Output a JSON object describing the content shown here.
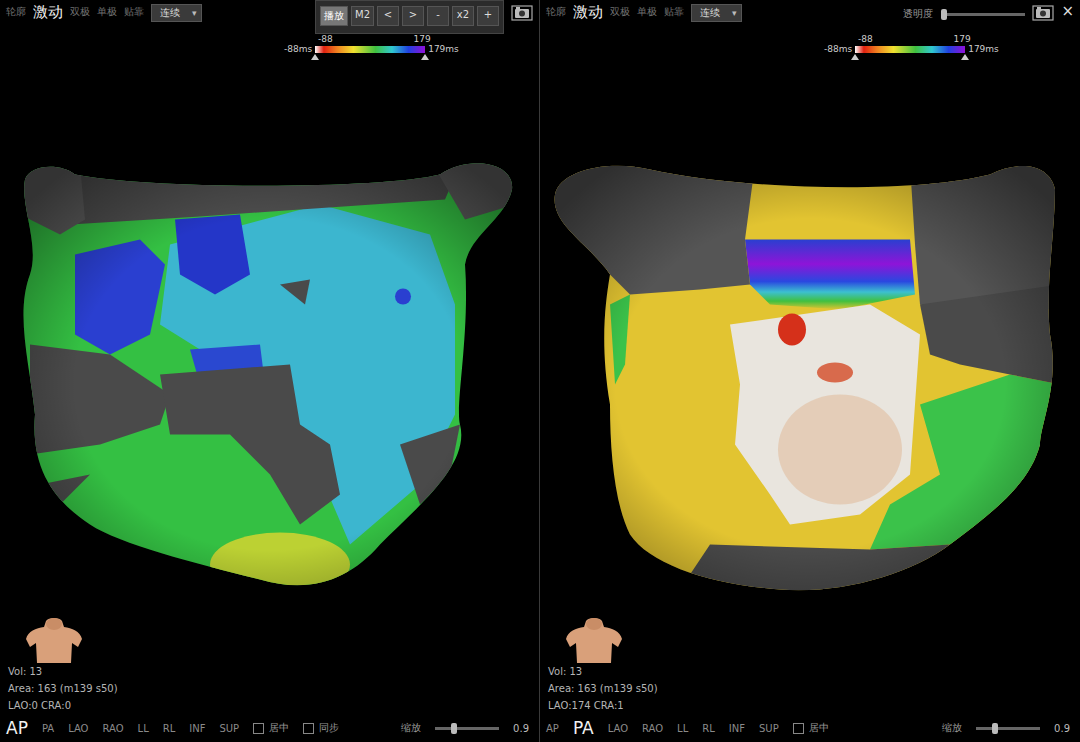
{
  "panels": [
    {
      "kind": "anterior",
      "modes": [
        {
          "label": "轮廓",
          "selected": false
        },
        {
          "label": "激动",
          "selected": true
        },
        {
          "label": "双极",
          "selected": false
        },
        {
          "label": "单极",
          "selected": false
        },
        {
          "label": "贴靠",
          "selected": false
        }
      ],
      "dropdown": {
        "value": "连续",
        "arrow": "▾"
      },
      "toolbar": [
        {
          "label": "播放",
          "selected": true
        },
        {
          "label": "M2",
          "selected": false
        },
        {
          "label": "<",
          "selected": false
        },
        {
          "label": ">",
          "selected": false
        },
        {
          "label": "-",
          "selected": false
        },
        {
          "label": "x2",
          "selected": false
        },
        {
          "label": "+",
          "selected": false
        }
      ],
      "scale": {
        "min_top": "-88",
        "max_top": "179",
        "min": "-88ms",
        "max": "179ms"
      },
      "info": [
        "Vol: 13",
        "Area: 163 (m139 s50)",
        "LAO:0 CRA:0"
      ],
      "views": [
        {
          "label": "AP",
          "selected": true
        },
        {
          "label": "PA",
          "selected": false
        },
        {
          "label": "LAO",
          "selected": false
        },
        {
          "label": "RAO",
          "selected": false
        },
        {
          "label": "LL",
          "selected": false
        },
        {
          "label": "RL",
          "selected": false
        },
        {
          "label": "INF",
          "selected": false
        },
        {
          "label": "SUP",
          "selected": false
        }
      ],
      "checkboxes": [
        {
          "label": "居中",
          "checked": false
        },
        {
          "label": "同步",
          "checked": false
        }
      ],
      "zoom": {
        "label": "缩放",
        "level": 0.3,
        "reading": "0.9"
      }
    },
    {
      "kind": "posterior",
      "modes": [
        {
          "label": "轮廓",
          "selected": false
        },
        {
          "label": "激动",
          "selected": true
        },
        {
          "label": "双极",
          "selected": false
        },
        {
          "label": "单极",
          "selected": false
        },
        {
          "label": "贴靠",
          "selected": false
        }
      ],
      "dropdown": {
        "value": "连续",
        "arrow": "▾"
      },
      "transparency": {
        "label": "透明度",
        "level": 0.03
      },
      "close": "×",
      "scale": {
        "min_top": "-88",
        "max_top": "179",
        "min": "-88ms",
        "max": "179ms"
      },
      "info": [
        "Vol: 13",
        "Area: 163 (m139 s50)",
        "LAO:174 CRA:1"
      ],
      "views": [
        {
          "label": "AP",
          "selected": false
        },
        {
          "label": "PA",
          "selected": true
        },
        {
          "label": "LAO",
          "selected": false
        },
        {
          "label": "RAO",
          "selected": false
        },
        {
          "label": "LL",
          "selected": false
        },
        {
          "label": "RL",
          "selected": false
        },
        {
          "label": "INF",
          "selected": false
        },
        {
          "label": "SUP",
          "selected": false
        }
      ],
      "checkboxes": [
        {
          "label": "居中",
          "checked": false
        }
      ],
      "zoom": {
        "label": "缩放",
        "level": 0.3,
        "reading": "0.9"
      }
    }
  ]
}
